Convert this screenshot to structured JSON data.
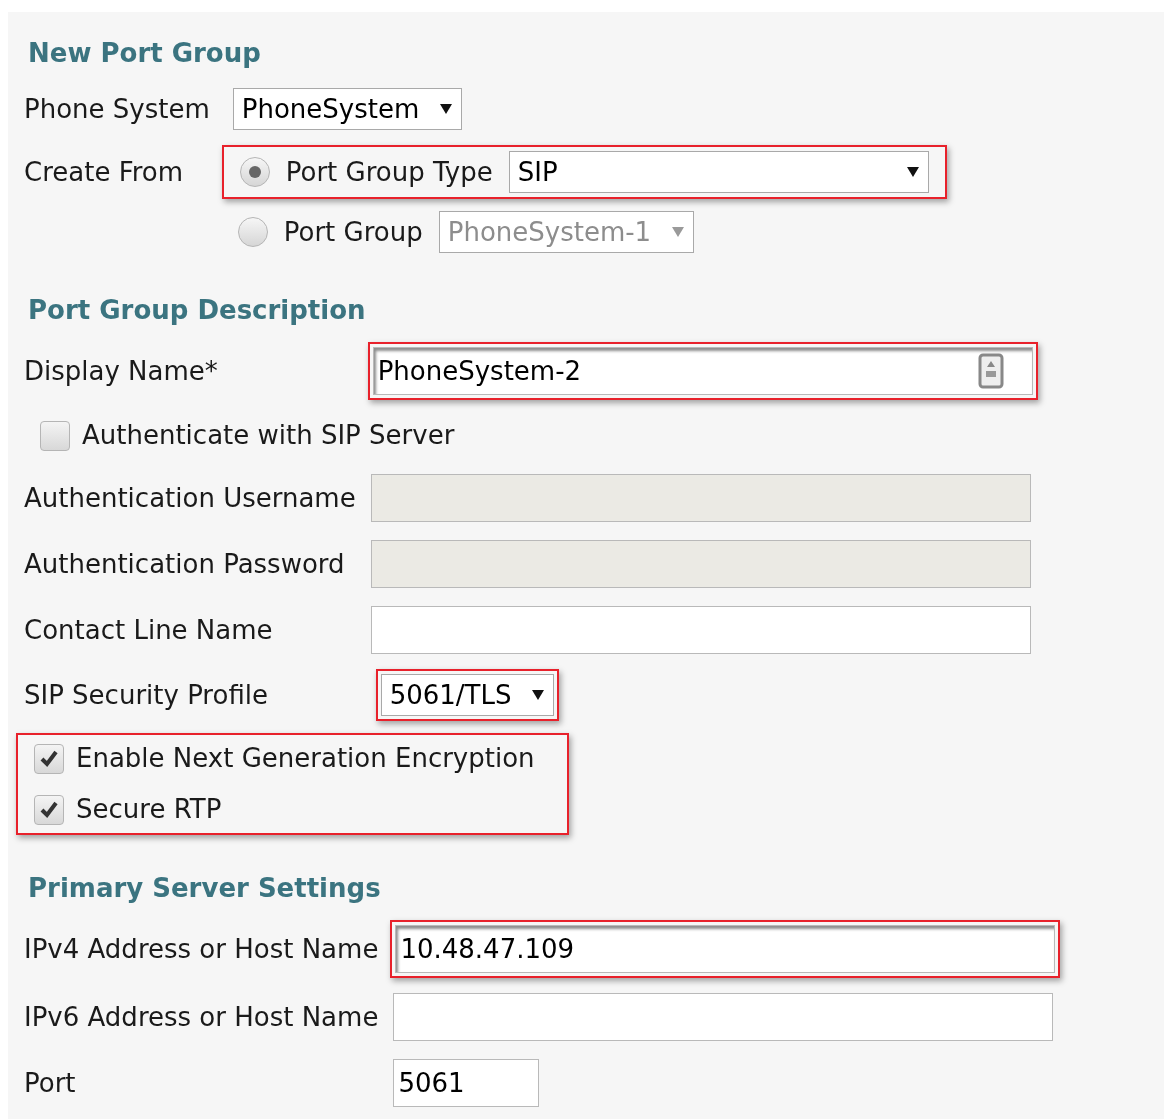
{
  "sections": [
    {
      "title": "New Port Group",
      "rows": [
        {
          "kind": "select",
          "label": "Phone System",
          "value": "PhoneSystem"
        },
        {
          "kind": "radios",
          "label": "Create From",
          "options": [
            {
              "label": "Port Group Type",
              "value": "SIP",
              "selected": true,
              "disabled": false,
              "highlighted": true
            },
            {
              "label": "Port Group",
              "value": "PhoneSystem-1",
              "selected": false,
              "disabled": true
            }
          ]
        }
      ]
    },
    {
      "title": "Port Group Description",
      "rows": [
        {
          "kind": "text",
          "label": "Display Name*",
          "value": "PhoneSystem-2",
          "disabled": false,
          "highlighted": true,
          "autofill_icon": true
        },
        {
          "kind": "checkboxes",
          "items": [
            {
              "label": "Authenticate with SIP Server",
              "checked": false
            }
          ]
        },
        {
          "kind": "text",
          "label": "Authentication Username",
          "disabled": true
        },
        {
          "kind": "text",
          "label": "Authentication Password",
          "disabled": true
        },
        {
          "kind": "text",
          "label": "Contact Line Name",
          "disabled": false
        },
        {
          "kind": "select",
          "label": "SIP Security Profile",
          "value": "5061/TLS",
          "highlighted": true
        },
        {
          "kind": "checkboxes",
          "highlighted": true,
          "items": [
            {
              "label": "Enable Next Generation Encryption",
              "checked": true
            },
            {
              "label": "Secure RTP",
              "checked": true
            }
          ]
        }
      ]
    },
    {
      "title": "Primary Server Settings",
      "rows": [
        {
          "kind": "text",
          "label": "IPv4 Address or Host Name",
          "value": "10.48.47.109",
          "disabled": false,
          "highlighted": true
        },
        {
          "kind": "text",
          "label": "IPv6 Address or Host Name",
          "disabled": false
        },
        {
          "kind": "short_text",
          "label": "Port",
          "value": "5061",
          "disabled": false
        }
      ]
    }
  ]
}
